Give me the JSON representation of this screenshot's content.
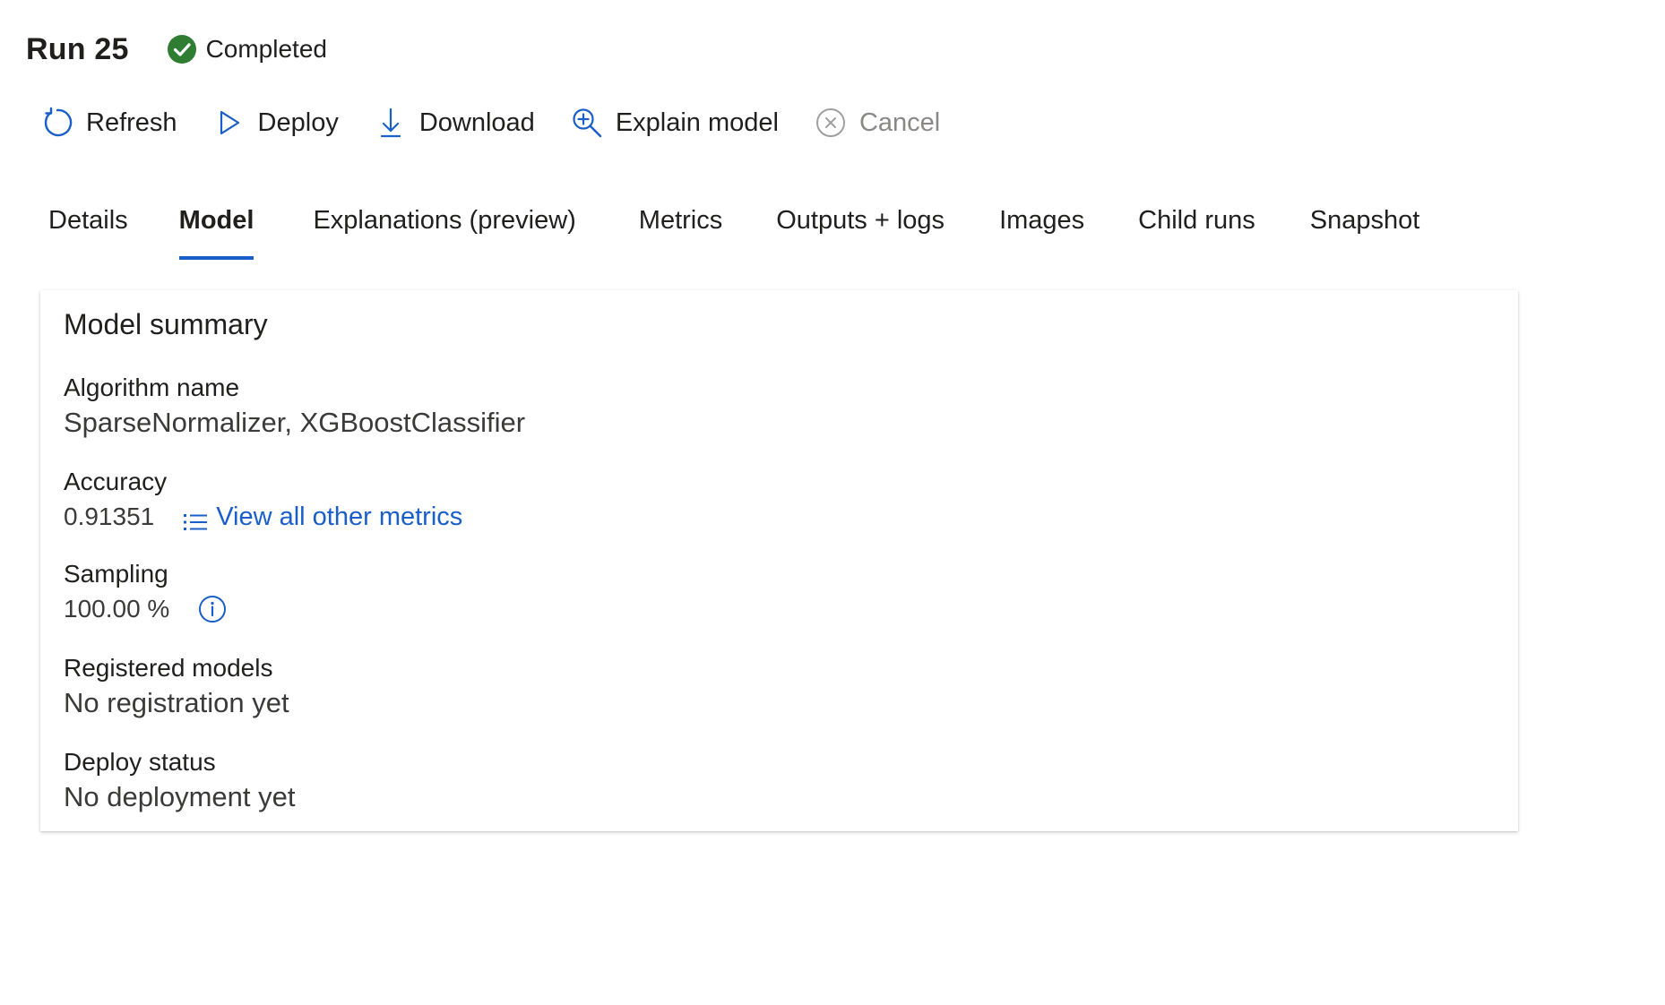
{
  "header": {
    "title": "Run 25",
    "status": "Completed",
    "status_icon": "check-circle-icon",
    "status_color": "#2e7d32"
  },
  "toolbar": {
    "refresh": {
      "label": "Refresh",
      "icon": "refresh-icon"
    },
    "deploy": {
      "label": "Deploy",
      "icon": "play-icon"
    },
    "download": {
      "label": "Download",
      "icon": "download-icon"
    },
    "explain": {
      "label": "Explain model",
      "icon": "zoom-in-icon"
    },
    "cancel": {
      "label": "Cancel",
      "icon": "cancel-circle-icon",
      "disabled": true
    }
  },
  "tabs": [
    {
      "label": "Details"
    },
    {
      "label": "Model",
      "active": true
    },
    {
      "label": "Explanations (preview)"
    },
    {
      "label": "Metrics"
    },
    {
      "label": "Outputs + logs"
    },
    {
      "label": "Images"
    },
    {
      "label": "Child runs"
    },
    {
      "label": "Snapshot"
    }
  ],
  "model_summary": {
    "title": "Model summary",
    "algorithm": {
      "label": "Algorithm name",
      "value": "SparseNormalizer, XGBoostClassifier"
    },
    "accuracy": {
      "label": "Accuracy",
      "value": "0.91351",
      "link_text": "View all other metrics",
      "link_icon": "list-icon"
    },
    "sampling": {
      "label": "Sampling",
      "value": "100.00 %",
      "info_icon": "info-icon"
    },
    "registered": {
      "label": "Registered models",
      "value": "No registration yet"
    },
    "deploy_status": {
      "label": "Deploy status",
      "value": "No deployment yet"
    }
  },
  "colors": {
    "accent": "#1a5fc9",
    "text": "#201f1e",
    "muted": "#8a8886"
  }
}
